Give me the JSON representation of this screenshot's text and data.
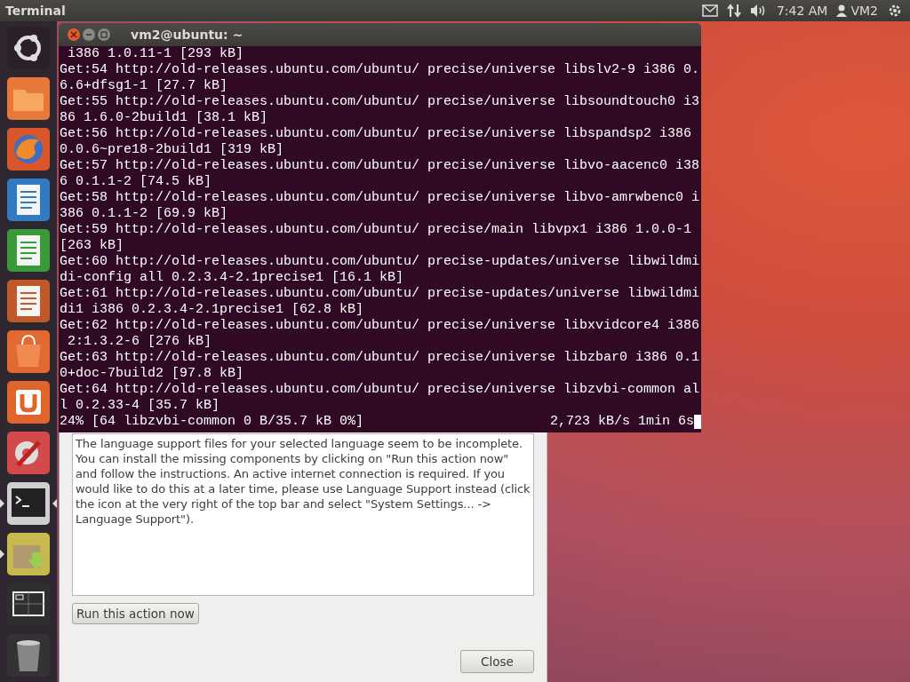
{
  "top_bar": {
    "app_title": "Terminal",
    "clock": "7:42 AM",
    "user": "VM2"
  },
  "launcher": [
    {
      "kind": "dash",
      "running": false,
      "focused": false
    },
    {
      "kind": "files",
      "running": false,
      "focused": false
    },
    {
      "kind": "browser",
      "running": false,
      "focused": false
    },
    {
      "kind": "writer",
      "running": false,
      "focused": false
    },
    {
      "kind": "calc",
      "running": false,
      "focused": false
    },
    {
      "kind": "impress",
      "running": false,
      "focused": false
    },
    {
      "kind": "store",
      "running": false,
      "focused": false
    },
    {
      "kind": "one",
      "running": false,
      "focused": false
    },
    {
      "kind": "settings",
      "running": false,
      "focused": false
    },
    {
      "kind": "terminal",
      "running": true,
      "focused": true
    },
    {
      "kind": "installer",
      "running": true,
      "focused": false
    },
    {
      "kind": "workspaces",
      "running": false,
      "focused": false
    },
    {
      "kind": "trash",
      "running": false,
      "focused": false
    }
  ],
  "terminal": {
    "title": "vm2@ubuntu: ~",
    "lines": [
      " i386 1.0.11-1 [293 kB]",
      "Get:54 http://old-releases.ubuntu.com/ubuntu/ precise/universe libslv2-9 i386 0.",
      "6.6+dfsg1-1 [27.7 kB]",
      "Get:55 http://old-releases.ubuntu.com/ubuntu/ precise/universe libsoundtouch0 i3",
      "86 1.6.0-2build1 [38.1 kB]",
      "Get:56 http://old-releases.ubuntu.com/ubuntu/ precise/universe libspandsp2 i386",
      "0.0.6~pre18-2build1 [319 kB]",
      "Get:57 http://old-releases.ubuntu.com/ubuntu/ precise/universe libvo-aacenc0 i38",
      "6 0.1.1-2 [74.5 kB]",
      "Get:58 http://old-releases.ubuntu.com/ubuntu/ precise/universe libvo-amrwbenc0 i",
      "386 0.1.1-2 [69.9 kB]",
      "Get:59 http://old-releases.ubuntu.com/ubuntu/ precise/main libvpx1 i386 1.0.0-1",
      "[263 kB]",
      "Get:60 http://old-releases.ubuntu.com/ubuntu/ precise-updates/universe libwildmi",
      "di-config all 0.2.3.4-2.1precise1 [16.1 kB]",
      "Get:61 http://old-releases.ubuntu.com/ubuntu/ precise-updates/universe libwildmi",
      "di1 i386 0.2.3.4-2.1precise1 [62.8 kB]",
      "Get:62 http://old-releases.ubuntu.com/ubuntu/ precise/universe libxvidcore4 i386",
      " 2:1.3.2-6 [276 kB]",
      "Get:63 http://old-releases.ubuntu.com/ubuntu/ precise/universe libzbar0 i386 0.1",
      "0+doc-7build2 [97.8 kB]",
      "Get:64 http://old-releases.ubuntu.com/ubuntu/ precise/universe libzvbi-common al",
      "l 0.2.33-4 [35.7 kB]"
    ],
    "progress": "24% [64 libzvbi-common 0 B/35.7 kB 0%]",
    "rate": "2,723 kB/s 1min 6s"
  },
  "dialog": {
    "message": "The language support files for your selected language seem to be incomplete. You can install the missing components by clicking on \"Run this action now\" and follow the instructions. An active internet connection is required. If you would like to do this at a later time, please use Language Support instead (click the icon at the very right of the top bar and select \"System Settings... -> Language Support\").",
    "action_button": "Run this action now",
    "close_button": "Close"
  }
}
